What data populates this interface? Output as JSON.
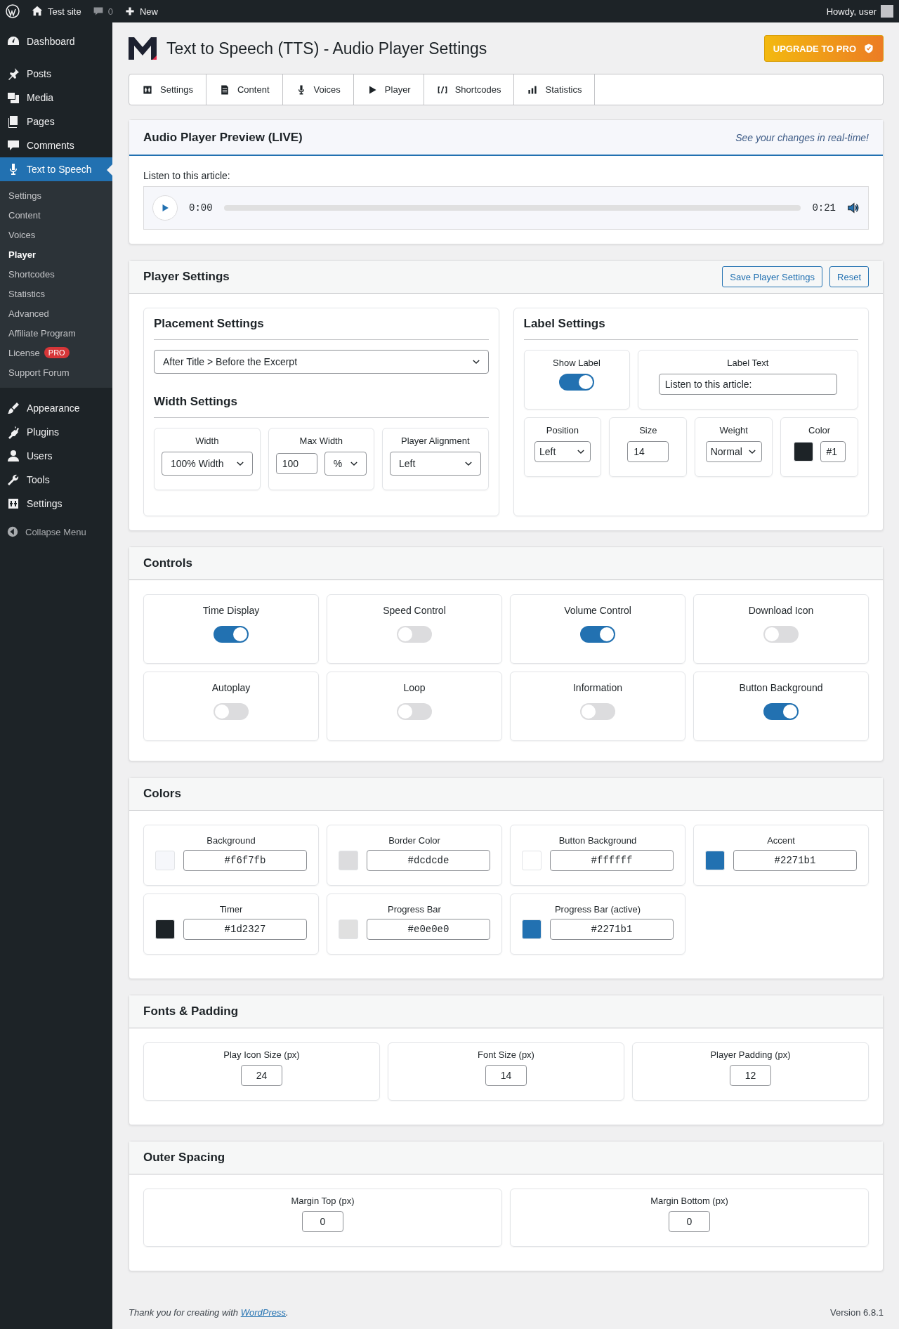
{
  "admin_bar": {
    "site": "Test site",
    "comments": "0",
    "new": "New",
    "greeting": "Howdy, user"
  },
  "sidebar": {
    "groups": [
      [
        {
          "label": "Dashboard",
          "selected": false
        }
      ],
      [
        {
          "label": "Posts",
          "selected": false
        },
        {
          "label": "Media",
          "selected": false
        },
        {
          "label": "Pages",
          "selected": false
        },
        {
          "label": "Comments",
          "selected": false
        },
        {
          "label": "Text to Speech",
          "selected": true,
          "children": [
            {
              "label": "Settings",
              "selected": false
            },
            {
              "label": "Content",
              "selected": false
            },
            {
              "label": "Voices",
              "selected": false
            },
            {
              "label": "Player",
              "selected": true
            },
            {
              "label": "Shortcodes",
              "selected": false
            },
            {
              "label": "Statistics",
              "selected": false
            },
            {
              "label": "Advanced",
              "selected": false
            },
            {
              "label": "Affiliate Program",
              "selected": false
            },
            {
              "label": "License",
              "selected": false,
              "badge": "PRO"
            },
            {
              "label": "Support Forum",
              "selected": false
            }
          ]
        }
      ],
      [
        {
          "label": "Appearance",
          "selected": false
        },
        {
          "label": "Plugins",
          "selected": false
        },
        {
          "label": "Users",
          "selected": false
        },
        {
          "label": "Tools",
          "selected": false
        },
        {
          "label": "Settings",
          "selected": false
        }
      ]
    ],
    "collapse": "Collapse Menu"
  },
  "header": {
    "title": "Text to Speech (TTS) - Audio Player Settings",
    "upgrade_button": "UPGRADE TO PRO"
  },
  "tabs": [
    {
      "label": "Settings",
      "selected": false
    },
    {
      "label": "Content",
      "selected": false
    },
    {
      "label": "Voices",
      "selected": false
    },
    {
      "label": "Player",
      "selected": false
    },
    {
      "label": "Shortcodes",
      "selected": false
    },
    {
      "label": "Statistics",
      "selected": false
    }
  ],
  "preview": {
    "title": "Audio Player Preview (LIVE)",
    "note": "See your changes in real-time!",
    "label": "Listen to this article:",
    "current": "0:00",
    "duration": "0:21",
    "level": 0
  },
  "player_settings": {
    "title": "Player Settings",
    "buttons": [
      "Save Player Settings",
      "Reset"
    ],
    "placement": {
      "title": "Placement Settings",
      "value": "After Title > Before the Excerpt"
    },
    "width": {
      "title": "Width Settings",
      "fields": [
        {
          "label": "Width",
          "controls": [
            {
              "kind": "select",
              "value": "100% Width"
            }
          ]
        },
        {
          "label": "Max Width",
          "controls": [
            {
              "kind": "input",
              "value": "100"
            },
            {
              "kind": "select",
              "value": "%"
            }
          ]
        },
        {
          "label": "Player Alignment",
          "controls": [
            {
              "kind": "select",
              "value": "Left"
            }
          ]
        }
      ]
    },
    "label": {
      "title": "Label Settings",
      "fields_top": [
        {
          "label": "Show Label",
          "controls": [
            {
              "kind": "toggle",
              "on": true
            }
          ]
        },
        {
          "label": "Label Text",
          "controls": [
            {
              "kind": "text",
              "value": "Listen to this article:"
            }
          ]
        }
      ],
      "fields_bottom": [
        {
          "label": "Position",
          "controls": [
            {
              "kind": "select",
              "value": "Left"
            }
          ]
        },
        {
          "label": "Size",
          "controls": [
            {
              "kind": "input",
              "value": "14"
            }
          ]
        },
        {
          "label": "Weight",
          "controls": [
            {
              "kind": "select",
              "value": "Normal"
            }
          ]
        },
        {
          "label": "Color",
          "controls": [
            {
              "kind": "swatch",
              "color": "#1d2327"
            },
            {
              "kind": "short",
              "value": "#1"
            }
          ]
        }
      ]
    }
  },
  "controls": {
    "title": "Controls",
    "items": [
      {
        "label": "Time Display",
        "on": true
      },
      {
        "label": "Speed Control",
        "on": false
      },
      {
        "label": "Volume Control",
        "on": true
      },
      {
        "label": "Download Icon",
        "on": false
      },
      {
        "label": "Autoplay",
        "on": false
      },
      {
        "label": "Loop",
        "on": false
      },
      {
        "label": "Information",
        "on": false
      },
      {
        "label": "Button Background",
        "on": true
      }
    ]
  },
  "colors": {
    "title": "Colors",
    "items": [
      {
        "label": "Background",
        "color": "#f6f7fb",
        "value": "#f6f7fb"
      },
      {
        "label": "Border Color",
        "color": "#dcdcde",
        "value": "#dcdcde"
      },
      {
        "label": "Button Background",
        "color": "#ffffff",
        "value": "#ffffff"
      },
      {
        "label": "Accent",
        "color": "#2271b1",
        "value": "#2271b1"
      },
      {
        "label": "Timer",
        "color": "#1d2327",
        "value": "#1d2327"
      },
      {
        "label": "Progress Bar",
        "color": "#e0e0e0",
        "value": "#e0e0e0"
      },
      {
        "label": "Progress Bar (active)",
        "color": "#2271b1",
        "value": "#2271b1"
      }
    ]
  },
  "fonts": {
    "title": "Fonts & Padding",
    "items": [
      {
        "label": "Play Icon Size (px)",
        "value": "24"
      },
      {
        "label": "Font Size (px)",
        "value": "14"
      },
      {
        "label": "Player Padding (px)",
        "value": "12"
      }
    ]
  },
  "outer_spacing": {
    "title": "Outer Spacing",
    "items": [
      {
        "label": "Margin Top (px)",
        "value": "0"
      },
      {
        "label": "Margin Bottom (px)",
        "value": "0"
      }
    ]
  },
  "footer": {
    "text": "Thank you for creating with ",
    "link": "WordPress",
    "end": ".",
    "version": "Version 6.8.1"
  }
}
